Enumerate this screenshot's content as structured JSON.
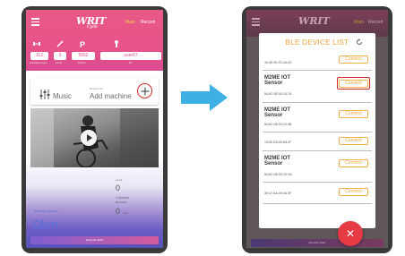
{
  "screen1": {
    "logo": "WRIT",
    "logo_sub": "Cycle",
    "tab_main": "Main",
    "tab_record": "Record",
    "stats": [
      {
        "value": "112",
        "label": "Activated days"
      },
      {
        "value": "3",
        "label": "Level"
      },
      {
        "value": "5552",
        "label": "Points"
      },
      {
        "value": "user67",
        "label": "ID"
      }
    ],
    "music_label": "Music",
    "device_caption": "Device info",
    "add_machine_label": "Add machine",
    "count_caption": "count",
    "count_value": "0",
    "calories_label": "Calories burned",
    "calories_value": "0",
    "calories_unit": "kcal",
    "distance_caption": "Running distance",
    "distance_value": "0km",
    "start_button": "Exercise Start"
  },
  "screen2": {
    "logo": "WRIT",
    "tab_main": "Main",
    "tab_record": "Record",
    "dialog_title": "BLE DEVICE LIST",
    "connect_label": "Connect",
    "devices": [
      {
        "name": "",
        "mac": "34:4E:90:7D:3A:20"
      },
      {
        "name": "M2ME IOT Sensor",
        "mac": "54:6C:0E:53:15:7A"
      },
      {
        "name": "M2ME IOT Sensor",
        "mac": "54:6C:0E:53:22:3B"
      },
      {
        "name": "",
        "mac": "13:50:D8:26:D8:2F"
      },
      {
        "name": "M2ME IOT Sensor",
        "mac": "54:6C:0E:53:1E:9A"
      },
      {
        "name": "",
        "mac": "35:47:AA:49:4A:3F"
      }
    ],
    "start_button": "Exercise Start"
  },
  "colors": {
    "brand_pink": "#e8538a",
    "accent_orange": "#f0a33b",
    "highlight_red": "#d12a2a",
    "arrow_blue": "#3fb0e6"
  }
}
